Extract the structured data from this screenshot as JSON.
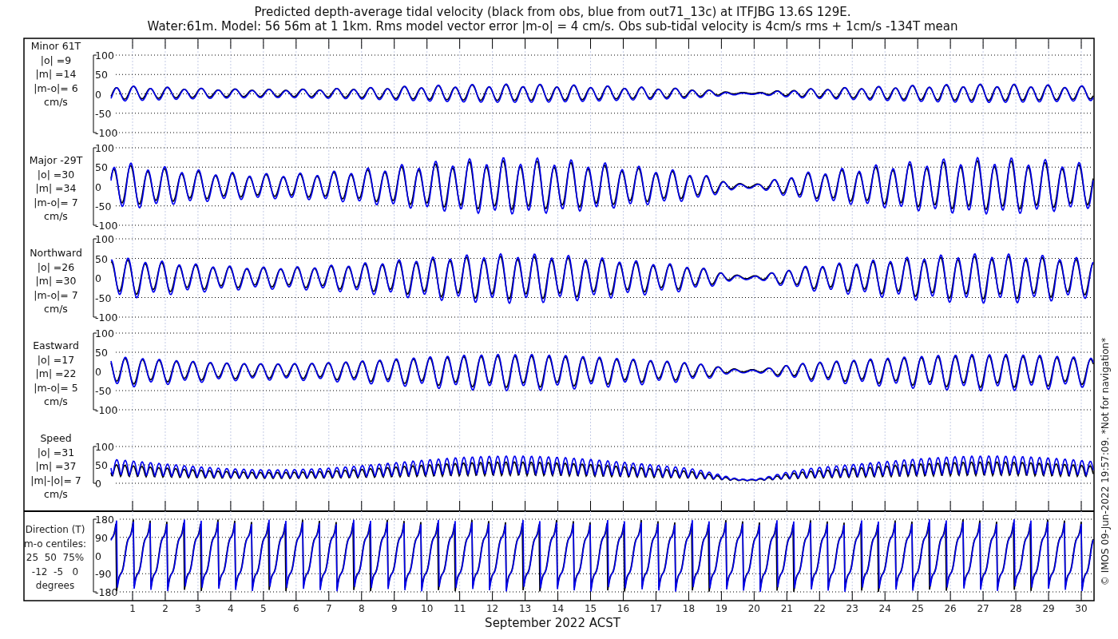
{
  "title": {
    "line_1": "Predicted depth-average tidal velocity (black from obs, blue from out71_13c) at ITFJBG 13.6S 129E.",
    "line_2": "Water:61m. Model: 56 56m at 1 1km. Rms model vector error |m-o| = 4 cm/s. Obs sub-tidal velocity is 4cm/s rms + 1cm/s -134T mean"
  },
  "panels": [
    {
      "kind": "signed",
      "label_lines": [
        "Minor 61T",
        "|o| =9",
        "|m| =14",
        "|m-o|= 6",
        "cm/s"
      ],
      "yticks": [
        "100",
        "50",
        "0",
        "-50",
        "-100"
      ]
    },
    {
      "kind": "signed",
      "label_lines": [
        "Major -29T",
        "|o| =30",
        "|m| =34",
        "|m-o|= 7",
        "cm/s"
      ],
      "yticks": [
        "100",
        "50",
        "0",
        "-50",
        "-100"
      ]
    },
    {
      "kind": "signed",
      "label_lines": [
        "Northward",
        "|o| =26",
        "|m| =30",
        "|m-o|= 7",
        "cm/s"
      ],
      "yticks": [
        "100",
        "50",
        "0",
        "-50",
        "-100"
      ]
    },
    {
      "kind": "signed",
      "label_lines": [
        "Eastward",
        "|o| =17",
        "|m| =22",
        "|m-o|= 5",
        "cm/s"
      ],
      "yticks": [
        "100",
        "50",
        "0",
        "-50",
        "-100"
      ]
    },
    {
      "kind": "speed",
      "label_lines": [
        "Speed",
        "|o| =31",
        "|m| =37",
        "|m|-|o|= 7",
        "cm/s"
      ],
      "yticks": [
        "100",
        "50",
        "0"
      ]
    },
    {
      "kind": "direction",
      "label_lines": [
        "Direction (T)",
        "m-o centiles:",
        "25  50  75%",
        "-12  -5   0",
        "degrees"
      ],
      "yticks": [
        "180",
        "90",
        "0",
        "-90",
        "-180"
      ]
    }
  ],
  "x_ticks": [
    "1",
    "2",
    "3",
    "4",
    "5",
    "6",
    "7",
    "8",
    "9",
    "10",
    "11",
    "12",
    "13",
    "14",
    "15",
    "16",
    "17",
    "18",
    "19",
    "20",
    "21",
    "22",
    "23",
    "24",
    "25",
    "26",
    "27",
    "28",
    "29",
    "30"
  ],
  "xlabel": "September 2022 ACST",
  "credit": "© IMOS 09-Jun-2022 19:57:09. *Not for navigation*"
}
